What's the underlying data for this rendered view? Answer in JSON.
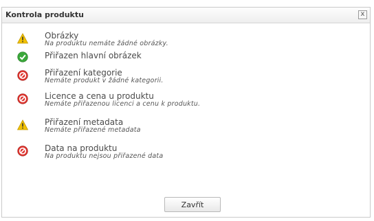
{
  "dialog": {
    "title": "Kontrola produktu",
    "close_glyph": "x",
    "items": [
      {
        "icon": "warning-icon",
        "label": "Obrázky",
        "description": "Na produktu nemáte žádné obrázky."
      },
      {
        "icon": "check-icon",
        "label": "Přiřazen hlavní obrázek",
        "description": ""
      },
      {
        "icon": "error-icon",
        "label": "Přiřazení kategorie",
        "description": "Nemáte produkt v žádné kategorii."
      },
      {
        "icon": "error-icon",
        "label": "Licence a cena u produktu",
        "description": "Nemáte přiřazenou licenci a cenu k produktu."
      },
      {
        "icon": "warning-icon",
        "label": "Přiřazení metadata",
        "description": "Nemáte přiřazené metadata"
      },
      {
        "icon": "error-icon",
        "label": "Data na produktu",
        "description": "Na produktu nejsou přiřazené data"
      }
    ],
    "close_button_label": "Zavřít"
  },
  "colors": {
    "warning": "#f2c100",
    "ok": "#3aa83a",
    "error": "#e0352f"
  }
}
